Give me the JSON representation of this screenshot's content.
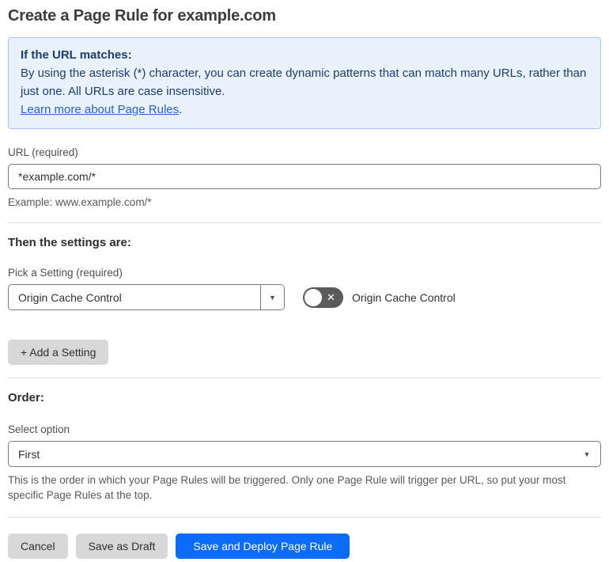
{
  "page": {
    "title": "Create a Page Rule for example.com"
  },
  "colors": {
    "accent_blue": "#0b6cf9",
    "info_box_background": "#e8f1fc",
    "info_box_border": "#a7c7ef",
    "info_box_text": "#1e3c70",
    "link_blue": "#2962c9",
    "button_gray": "#d8d8d8",
    "toggle_off_gray": "#5b5b5b"
  },
  "info_box": {
    "heading": "If the URL matches:",
    "body": "By using the asterisk (*) character, you can create dynamic patterns that can match many URLs, rather than just one. All URLs are case insensitive.",
    "link": "Learn more about Page Rules",
    "link_suffix": "."
  },
  "url_section": {
    "label": "URL (required)",
    "input_value": "*example.com/*",
    "helper": "Example: www.example.com/*"
  },
  "settings_section": {
    "heading": "Then the settings are:",
    "picker_label": "Pick a Setting (required)",
    "selected_setting": "Origin Cache Control",
    "toggle_label": "Origin Cache Control",
    "toggle_state": "off",
    "add_button": "+ Add a Setting"
  },
  "order_section": {
    "heading": "Order:",
    "select_label": "Select option",
    "selected_option": "First",
    "helper": "This is the order in which your Page Rules will be triggered. Only one Page Rule will trigger per URL, so put your most specific Page Rules at the top."
  },
  "footer": {
    "cancel": "Cancel",
    "save_draft": "Save as Draft",
    "save_deploy": "Save and Deploy Page Rule"
  },
  "icons": {
    "dropdown_caret": "▼",
    "toggle_off_glyph": "✕"
  }
}
